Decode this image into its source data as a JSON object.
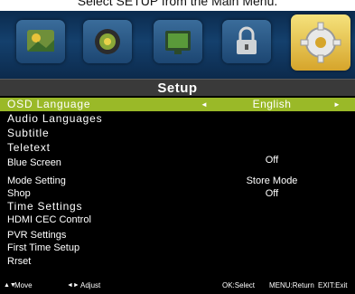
{
  "caption": "Select SETUP from the Main Menu.",
  "banner": {
    "icons": [
      {
        "name": "picture-icon"
      },
      {
        "name": "sound-icon"
      },
      {
        "name": "channel-icon"
      },
      {
        "name": "lock-icon"
      },
      {
        "name": "setup-gear-icon",
        "selected": true
      }
    ]
  },
  "header": {
    "title": "Setup"
  },
  "menu": {
    "items": [
      {
        "label": "OSD Language",
        "value": "English"
      },
      {
        "label": "Audio Languages",
        "value": ""
      },
      {
        "label": "Subtitle",
        "value": ""
      },
      {
        "label": "Teletext",
        "value": ""
      },
      {
        "label": "Blue Screen",
        "value": "Off"
      },
      {
        "label": "Mode Setting",
        "value": "Store Mode"
      },
      {
        "label": "Shop",
        "value": "Off"
      },
      {
        "label": "Time Settings",
        "value": ""
      },
      {
        "label": "HDMI CEC Control",
        "value": ""
      },
      {
        "label": "PVR Settings",
        "value": ""
      },
      {
        "label": "First Time Setup",
        "value": ""
      },
      {
        "label": "Rrset",
        "value": ""
      }
    ],
    "left_arrow": "◄",
    "right_arrow": "►"
  },
  "footer": {
    "move_icon": "▲▼",
    "move": "Move",
    "adjust_icon": "◄►",
    "adjust": "Adjust",
    "select": "OK:Select",
    "return": "MENU:Return",
    "exit": "EXIT:Exit"
  },
  "colors": {
    "highlight": "#9ab928",
    "header": "#3a3a3a",
    "banner": "#14406d"
  }
}
